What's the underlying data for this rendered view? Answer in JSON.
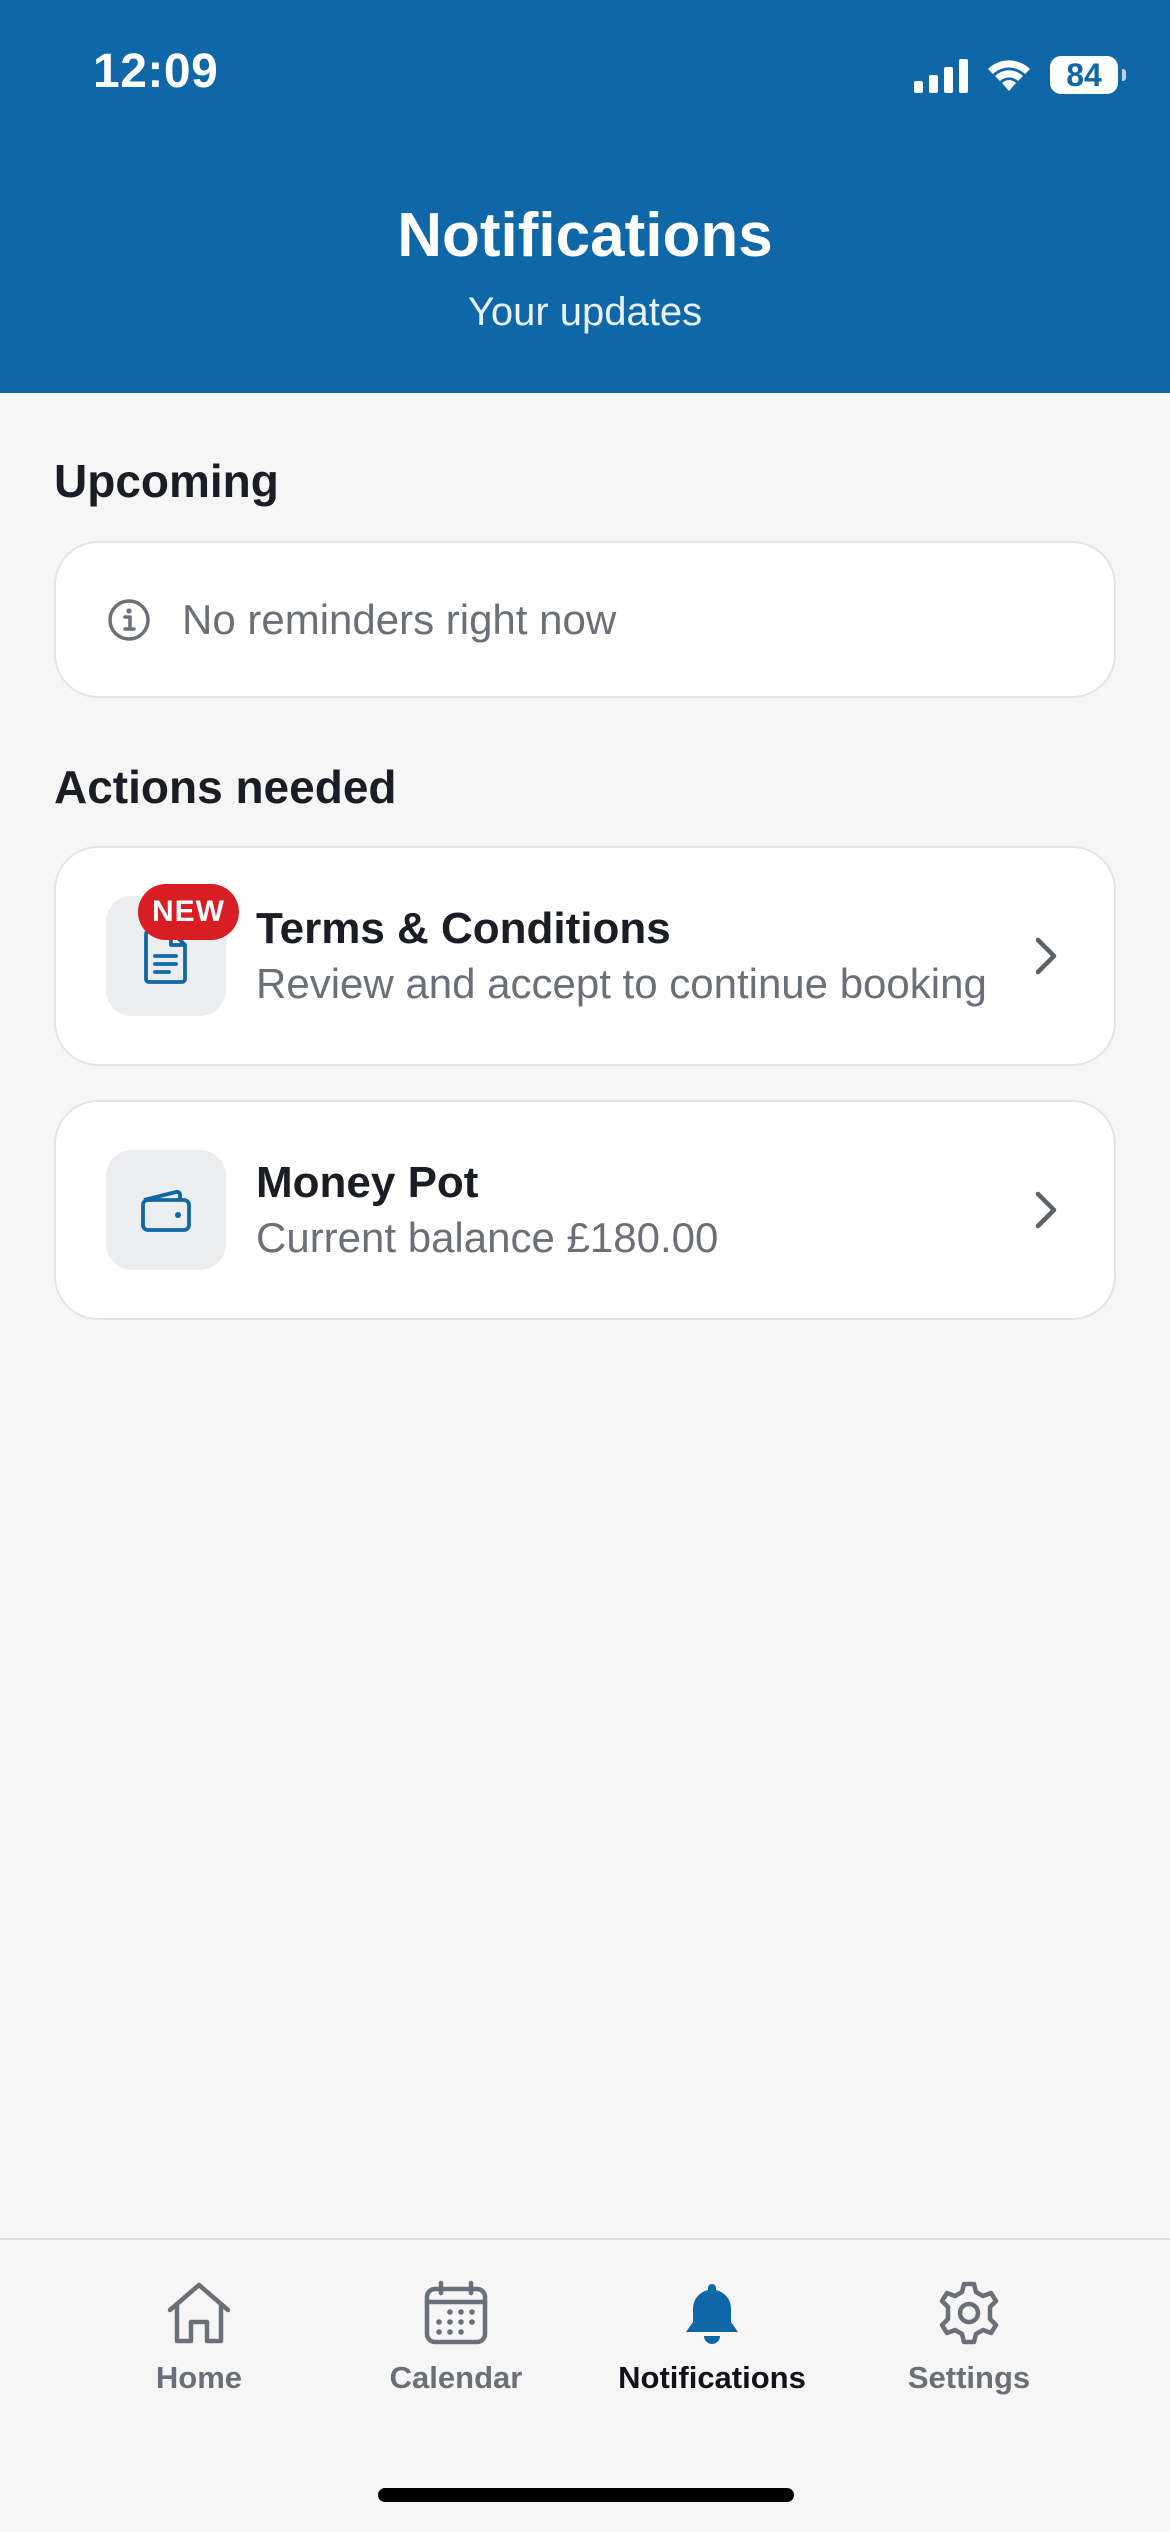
{
  "status_bar": {
    "time": "12:09",
    "battery": "84"
  },
  "header": {
    "title": "Notifications",
    "subtitle": "Your updates"
  },
  "sections": {
    "upcoming": {
      "title": "Upcoming",
      "empty_message": "No reminders right now",
      "empty_icon": "info-icon"
    },
    "actions": {
      "title": "Actions needed",
      "items": [
        {
          "title": "Terms & Conditions",
          "subtitle": "Review and accept to continue booking",
          "badge": "NEW",
          "icon": "document-icon"
        },
        {
          "title": "Money Pot",
          "subtitle": "Current balance £180.00",
          "icon": "wallet-icon"
        }
      ]
    }
  },
  "tabbar": {
    "tabs": [
      {
        "label": "Home",
        "icon": "home-icon",
        "active": false
      },
      {
        "label": "Calendar",
        "icon": "calendar-icon",
        "active": false
      },
      {
        "label": "Notifications",
        "icon": "bell-icon",
        "active": true
      },
      {
        "label": "Settings",
        "icon": "gear-icon",
        "active": false
      }
    ]
  },
  "colors": {
    "brand": "#0f67a7",
    "badge": "#d81e23",
    "background": "#f6f6f7",
    "text_primary": "#1a1d24",
    "text_secondary": "#6b6f78"
  }
}
